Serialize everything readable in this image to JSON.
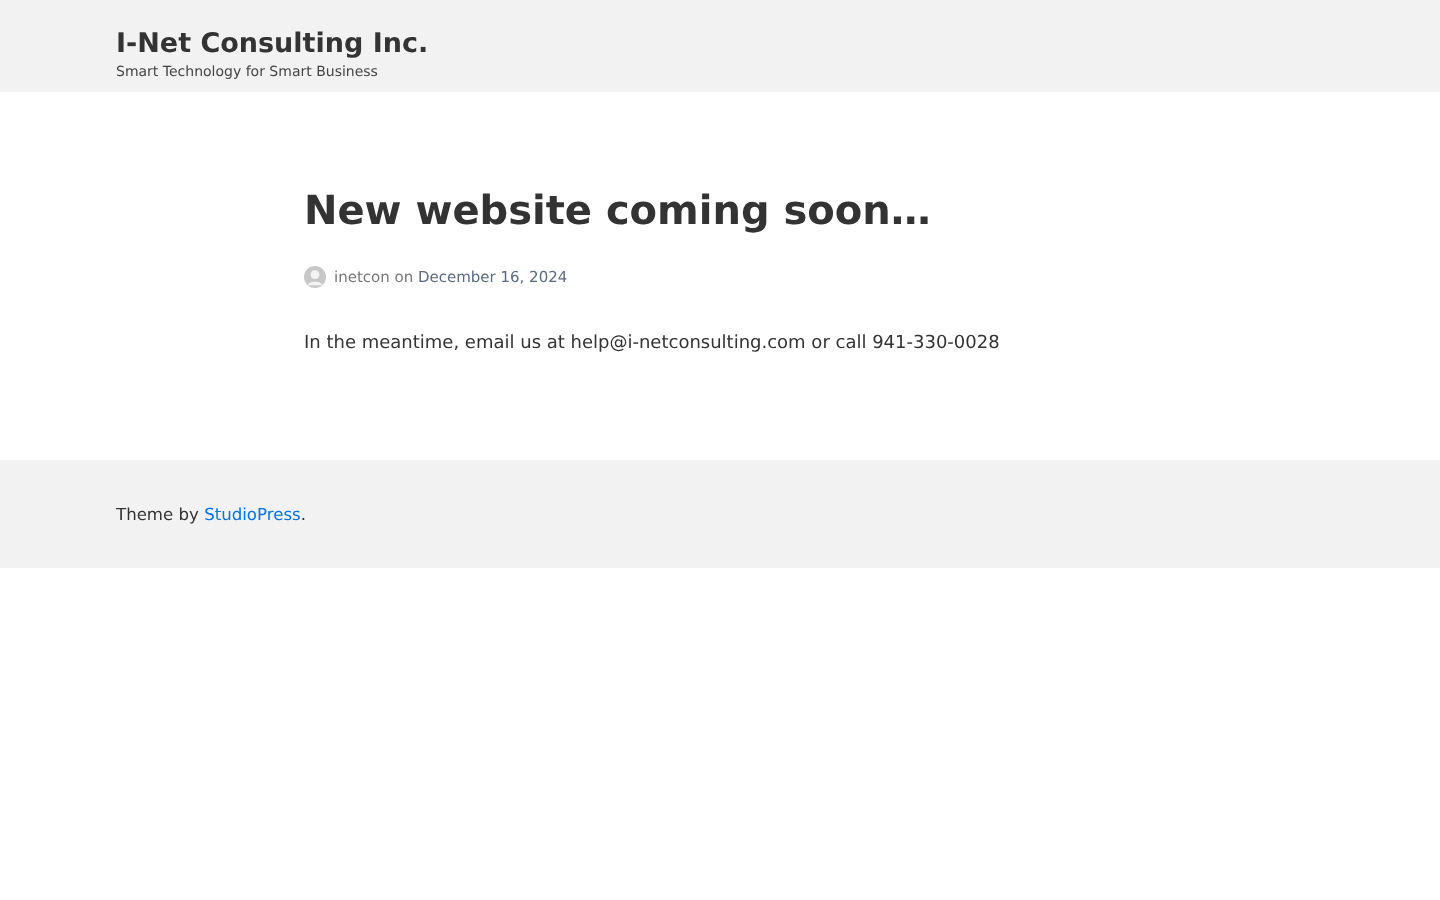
{
  "site": {
    "title": "I-Net Consulting Inc.",
    "tagline": "Smart Technology for Smart Business"
  },
  "post": {
    "title": "New website coming soon…",
    "author": "inetcon",
    "joiner": "on",
    "date": "December 16, 2024",
    "body": "In the meantime, email us at help@i-netconsulting.com or call 941-330-0028"
  },
  "footer": {
    "prefix": "Theme by",
    "link": "StudioPress",
    "suffix": "."
  }
}
